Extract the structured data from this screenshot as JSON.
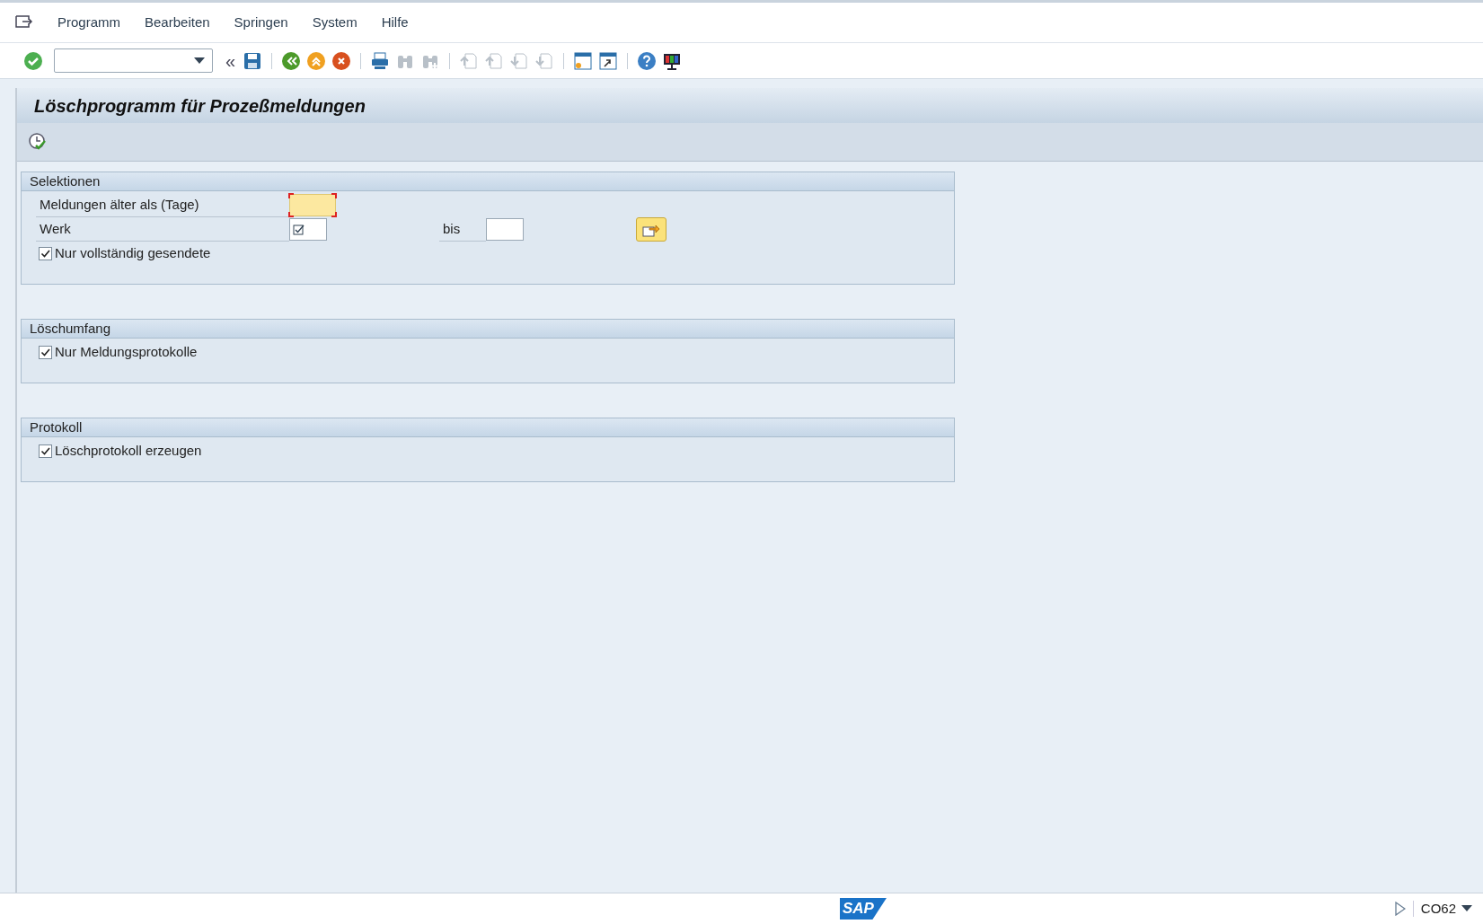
{
  "menu": [
    "Programm",
    "Bearbeiten",
    "Springen",
    "System",
    "Hilfe"
  ],
  "toolbar": {
    "items": [
      {
        "kind": "enter",
        "disabled": false
      },
      {
        "kind": "field"
      },
      {
        "kind": "chevrons",
        "label": "«",
        "disabled": false
      },
      {
        "kind": "save",
        "disabled": false
      },
      {
        "kind": "sep"
      },
      {
        "kind": "back",
        "disabled": false
      },
      {
        "kind": "exit",
        "disabled": false
      },
      {
        "kind": "cancel",
        "disabled": false
      },
      {
        "kind": "sep"
      },
      {
        "kind": "print",
        "disabled": false
      },
      {
        "kind": "find",
        "disabled": true
      },
      {
        "kind": "find-next",
        "disabled": true
      },
      {
        "kind": "sep"
      },
      {
        "kind": "page-first",
        "disabled": true
      },
      {
        "kind": "page-prev",
        "disabled": true
      },
      {
        "kind": "page-next",
        "disabled": true
      },
      {
        "kind": "page-last",
        "disabled": true
      },
      {
        "kind": "sep"
      },
      {
        "kind": "new-session",
        "disabled": false
      },
      {
        "kind": "shortcut",
        "disabled": false
      },
      {
        "kind": "sep"
      },
      {
        "kind": "help",
        "disabled": false
      },
      {
        "kind": "layout",
        "disabled": false
      }
    ]
  },
  "title": "Löschprogramm für Prozeßmeldungen",
  "app_toolbar": [
    {
      "kind": "execute"
    }
  ],
  "blocks": [
    {
      "title": "Selektionen",
      "rows": [
        {
          "kind": "field",
          "label": "Meldungen älter als (Tage)",
          "required": true,
          "value": ""
        },
        {
          "kind": "range",
          "label": "Werk",
          "multi_marker": true,
          "value": "",
          "to_label": "bis",
          "to_value": ""
        },
        {
          "kind": "checkbox",
          "label": "Nur vollständig gesendete",
          "checked": true
        }
      ]
    },
    {
      "title": "Löschumfang",
      "rows": [
        {
          "kind": "checkbox",
          "label": "Nur Meldungsprotokolle",
          "checked": true
        }
      ]
    },
    {
      "title": "Protokoll",
      "rows": [
        {
          "kind": "checkbox",
          "label": "Löschprotokoll erzeugen",
          "checked": true
        }
      ]
    }
  ],
  "status_bar": {
    "logo_text": "SAP",
    "transaction": "CO62"
  }
}
